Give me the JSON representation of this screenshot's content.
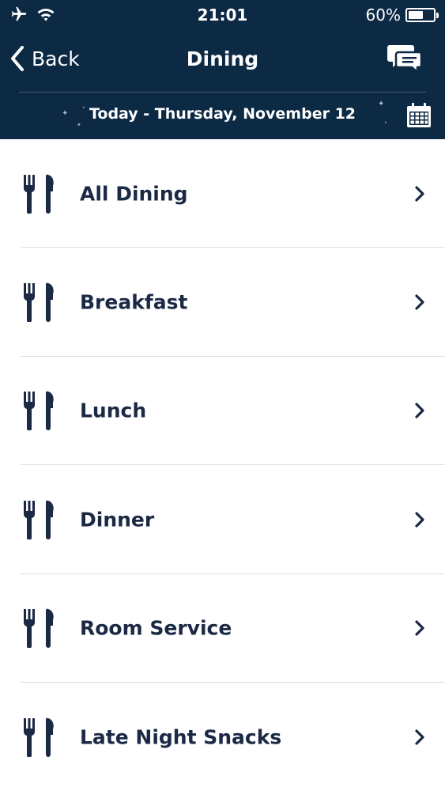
{
  "status_bar": {
    "time": "21:01",
    "battery_text": "60%",
    "battery_level": 0.6
  },
  "nav": {
    "back_label": "Back",
    "title": "Dining"
  },
  "date_bar": {
    "text": "Today - Thursday, November 12"
  },
  "menu": {
    "items": [
      {
        "label": "All Dining"
      },
      {
        "label": "Breakfast"
      },
      {
        "label": "Lunch"
      },
      {
        "label": "Dinner"
      },
      {
        "label": "Room Service"
      },
      {
        "label": "Late Night Snacks"
      }
    ]
  },
  "colors": {
    "header_bg": "#0d2a45",
    "text_dark": "#1b2945",
    "separator": "#d9dde2"
  }
}
